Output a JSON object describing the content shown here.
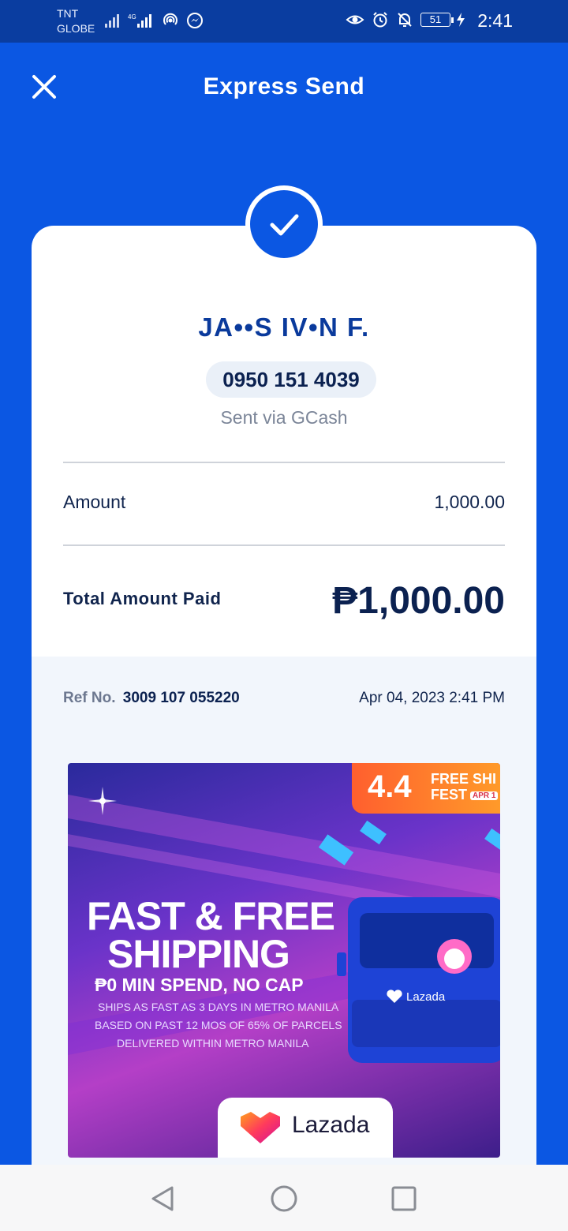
{
  "status_bar": {
    "carrier_line1": "TNT",
    "carrier_line2": "GLOBE",
    "battery": "51",
    "time": "2:41"
  },
  "header": {
    "title": "Express Send",
    "close_icon": "close-icon"
  },
  "receipt": {
    "status_icon": "check-icon",
    "recipient_name": "JA••S IV•N F.",
    "phone": "0950 151 4039",
    "sent_via": "Sent via GCash",
    "amount_label": "Amount",
    "amount_value": "1,000.00",
    "total_label": "Total Amount Paid",
    "total_value": "₱1,000.00",
    "ref_label": "Ref No.",
    "ref_number": "3009 107 055220",
    "date": "Apr 04, 2023 2:41 PM"
  },
  "ad": {
    "badge_number": "4.4",
    "badge_line1": "FREE SHI",
    "badge_line2": "FEST",
    "badge_line3": "APR 1",
    "headline_line1": "FAST & FREE",
    "headline_line2": "SHIPPING",
    "subhead": "₱0 MIN SPEND, NO CAP",
    "fine_line1": "SHIPS AS FAST AS 3 DAYS IN METRO MANILA",
    "fine_line2": "BASED ON PAST 12 MOS OF 65% OF PARCELS",
    "fine_line3": "DELIVERED WITHIN METRO MANILA",
    "truck_brand": "Lazada",
    "brand": "Lazada"
  },
  "navigation": {
    "back_icon": "back-triangle-icon",
    "home_icon": "home-circle-icon",
    "recents_icon": "recents-square-icon"
  },
  "colors": {
    "primary": "#0b57e3",
    "status_bar": "#0a3da0",
    "text_dark": "#0b2150"
  }
}
